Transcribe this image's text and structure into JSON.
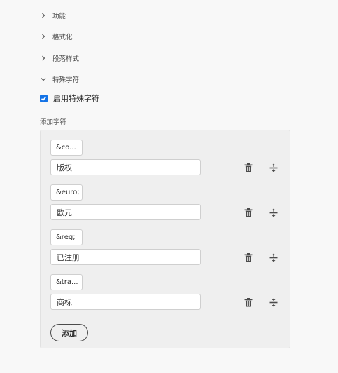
{
  "sections": [
    {
      "label": "功能"
    },
    {
      "label": "格式化"
    },
    {
      "label": "段落样式"
    },
    {
      "label": "特殊字符"
    }
  ],
  "enable_checkbox": {
    "label": "启用特殊字符",
    "checked": true
  },
  "add_chars_label": "添加字符",
  "rows": [
    {
      "code": "&co...",
      "name": "版权"
    },
    {
      "code": "&euro;",
      "name": "欧元"
    },
    {
      "code": "&reg;",
      "name": "已注册"
    },
    {
      "code": "&tra...",
      "name": "商标"
    }
  ],
  "add_button": "添加",
  "colors": {
    "accent": "#1473e6",
    "icon": "#4b4b4b"
  },
  "icons": {
    "delete": "trash-icon",
    "reorder": "drag-handle-icon",
    "collapsed": "chevron-right-icon",
    "expanded": "chevron-down-icon"
  }
}
